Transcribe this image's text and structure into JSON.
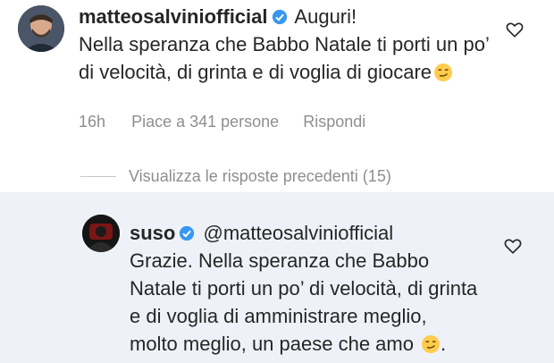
{
  "main_comment": {
    "username": "matteosalviniofficial",
    "text_lead": "Auguri!",
    "text_body": "Nella speranza che Babbo Natale ti porti un po’ di velocità, di grinta e di voglia di giocare",
    "emoji_icon": "smirk-emoji-icon",
    "time": "16h",
    "likes": "Piace a 341 persone",
    "reply_label": "Rispondi"
  },
  "view_previous_replies": "Visualizza le risposte precedenti (15)",
  "reply_comment": {
    "username": "suso",
    "mention": "@matteosalviniofficial",
    "text_body": "Grazie. Nella speranza che Babbo Natale ti porti un po’ di velocità, di grinta e di voglia di amministrare meglio, molto meglio, un paese che amo",
    "trailing": ".",
    "emoji_icon": "smirk-emoji-icon"
  },
  "colors": {
    "verified_badge": "#3897f0",
    "secondary_text": "#8e8e8e",
    "reply_background": "#eef2f8"
  }
}
